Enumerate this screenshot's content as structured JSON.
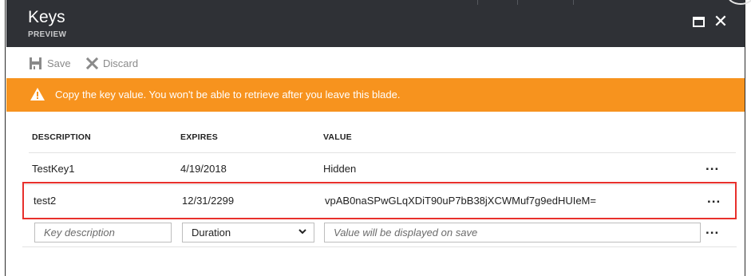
{
  "blade": {
    "title": "Keys",
    "subtitle": "PREVIEW",
    "maximize_icon": "maximize-icon",
    "close_icon": "close-icon",
    "close_glyph": "✕"
  },
  "toolbar": {
    "save_label": "Save",
    "discard_label": "Discard",
    "save_icon": "floppy-disk-icon",
    "discard_icon": "x-icon"
  },
  "banner": {
    "icon": "warning-icon",
    "text": "Copy the key value. You won't be able to retrieve after you leave this blade.",
    "color": "#f7931e"
  },
  "table": {
    "headers": {
      "description": "DESCRIPTION",
      "expires": "EXPIRES",
      "value": "VALUE"
    },
    "rows": [
      {
        "description": "TestKey1",
        "expires": "4/19/2018",
        "value": "Hidden",
        "more": "..."
      },
      {
        "description": "test2",
        "expires": "12/31/2299",
        "value": "vpAB0naSPwGLqXDiT90uP7bB38jXCWMuf7g9edHUIeM=",
        "more": "...",
        "highlighted": true,
        "highlight_color": "#e8302c"
      }
    ],
    "new_row": {
      "description_placeholder": "Key description",
      "duration_value": "Duration",
      "value_placeholder": "Value will be displayed on save",
      "more": "..."
    }
  },
  "colors": {
    "header_bg": "#2f3136",
    "accent_orange": "#f7931e",
    "highlight_red": "#e8302c"
  }
}
